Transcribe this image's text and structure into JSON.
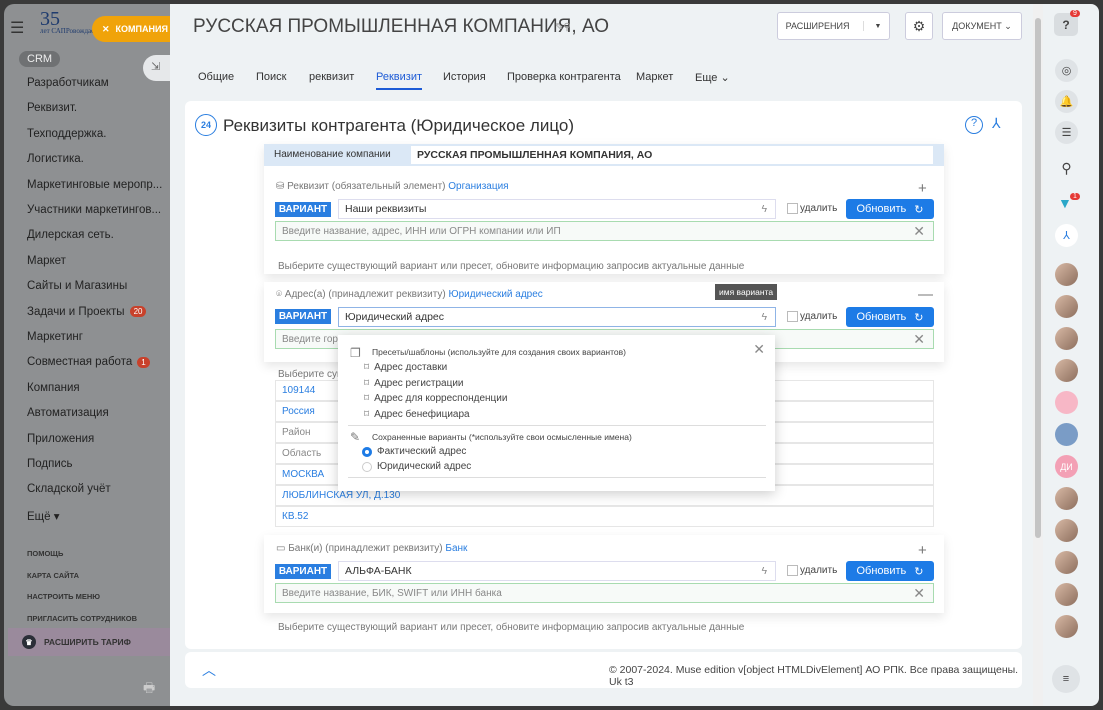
{
  "sidebar": {
    "logo_text": "35 лет САПРовождаем",
    "company_button": "КОМПАНИЯ",
    "crm_label": "CRM",
    "items": [
      {
        "label": "Разработчикам"
      },
      {
        "label": "Реквизит."
      },
      {
        "label": "Техподдержка."
      },
      {
        "label": "Логистика."
      },
      {
        "label": "Маркетинговые меропр..."
      },
      {
        "label": "Участники маркетингов..."
      },
      {
        "label": "Дилерская сеть."
      },
      {
        "label": "Маркет"
      },
      {
        "label": "Сайты и Магазины"
      },
      {
        "label": "Задачи и Проекты",
        "badge": "20"
      },
      {
        "label": "Маркетинг"
      },
      {
        "label": "Совместная работа",
        "badge": "1"
      },
      {
        "label": "Компания"
      },
      {
        "label": "Автоматизация"
      },
      {
        "label": "Приложения"
      },
      {
        "label": "Подпись"
      },
      {
        "label": "Складской учёт"
      },
      {
        "label": "Ещё ▾"
      }
    ],
    "footer": [
      "ПОМОЩЬ",
      "КАРТА САЙТА",
      "НАСТРОИТЬ МЕНЮ",
      "ПРИГЛАСИТЬ СОТРУДНИКОВ"
    ],
    "upgrade": "РАСШИРИТЬ ТАРИФ"
  },
  "header": {
    "title": "РУССКАЯ ПРОМЫШЛЕННАЯ КОМПАНИЯ, АО",
    "extensions": "РАСШИРЕНИЯ",
    "document": "ДОКУМЕНТ"
  },
  "tabs": [
    {
      "label": "Общие"
    },
    {
      "label": "Поиск"
    },
    {
      "label": "реквизит"
    },
    {
      "label": "Реквизит",
      "active": true
    },
    {
      "label": "История"
    },
    {
      "label": "Проверка контрагента"
    },
    {
      "label": "Маркет"
    },
    {
      "label": "Еще"
    }
  ],
  "card": {
    "title": "Реквизиты контрагента (Юридическое лицо)",
    "company_name_label": "Наименование компании",
    "company_name_value": "РУССКАЯ ПРОМЫШЛЕННАЯ КОМПАНИЯ, АО",
    "variant_label": "ВАРИАНТ",
    "delete_label": "удалить",
    "update_label": "Обновить",
    "hint": "Выберите существующий вариант или пресет, обновите информацию запросив актуальные данные",
    "requisite": {
      "title": "Реквизит (обязательный элемент)",
      "link": "Организация",
      "value": "Наши реквизиты",
      "search_placeholder": "Введите название, адрес, ИНН или ОГРН компании или ИП"
    },
    "address": {
      "title": "Адрес(а) (принадлежит реквизиту)",
      "link": "Юридический адрес",
      "value": "Юридический адрес",
      "tooltip": "имя варианта",
      "search_placeholder": "Введите город",
      "hint_short": "Выберите сущ",
      "fields": [
        {
          "value": "109144",
          "filled": true
        },
        {
          "value": "Россия",
          "filled": true
        },
        {
          "value": "Район",
          "filled": false
        },
        {
          "value": "Область",
          "filled": false
        },
        {
          "value": "МОСКВА",
          "filled": true
        },
        {
          "value": "ЛЮБЛИНСКАЯ УЛ, Д.130",
          "filled": true
        },
        {
          "value": "КВ.52",
          "filled": true
        }
      ]
    },
    "bank": {
      "title": "Банк(и) (принадлежит реквизиту)",
      "link": "Банк",
      "value": "АЛЬФА-БАНК",
      "search_placeholder": "Введите название, БИК, SWIFT или ИНН банка"
    }
  },
  "popup": {
    "presets_title": "Пресеты/шаблоны (используйте для создания своих вариантов)",
    "presets": [
      "Адрес доставки",
      "Адрес регистрации",
      "Адрес для корреспонденции",
      "Адрес бенефициара"
    ],
    "saved_title": "Сохраненные варианты (*используйте свои осмысленные имена)",
    "saved": [
      {
        "label": "Фактический адрес",
        "selected": true
      },
      {
        "label": "Юридический адрес",
        "selected": false
      }
    ]
  },
  "footer": {
    "copyright": "© 2007-2024. Muse edition v[object HTMLDivElement] АО РПК. Все права защищены. Uk t3"
  },
  "right_panel": {
    "help_badge": "9",
    "funnel_badge": "1",
    "avatar_initials": "ДИ"
  }
}
